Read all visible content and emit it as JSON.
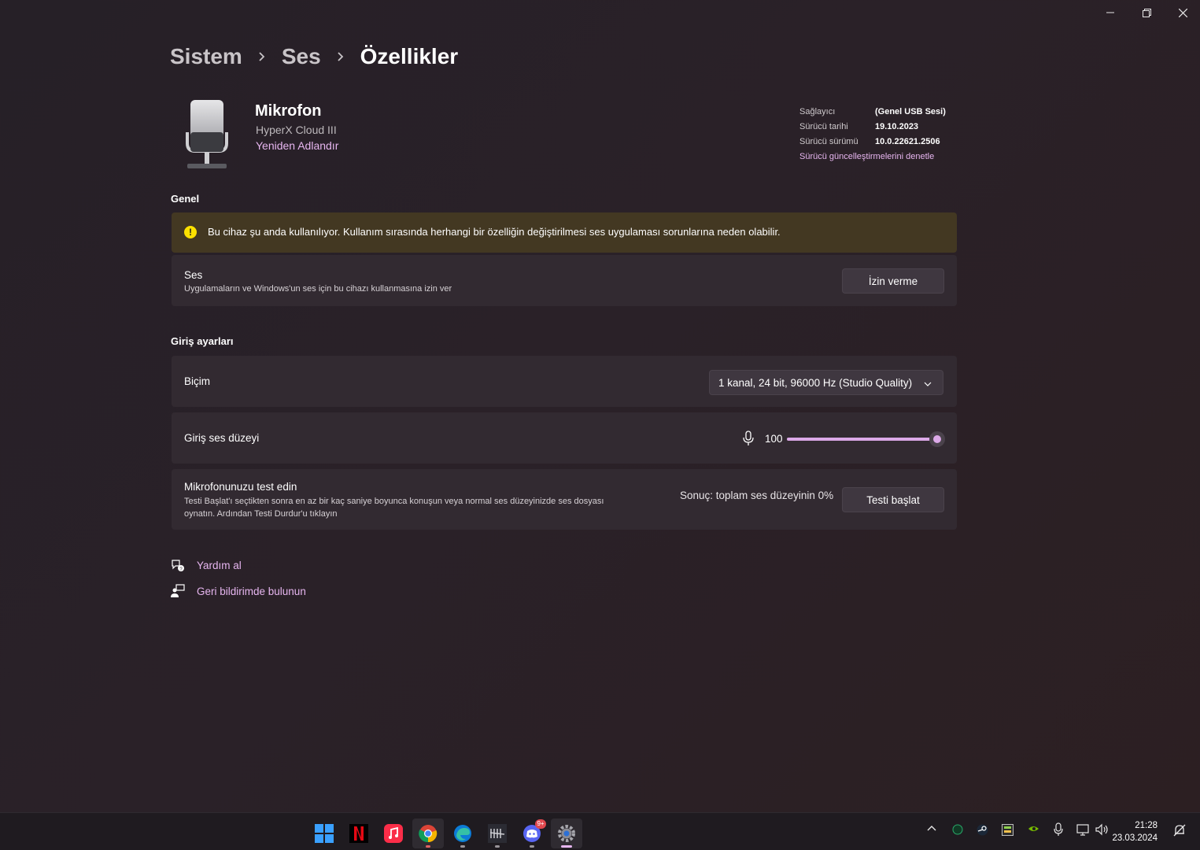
{
  "breadcrumb": {
    "item1": "Sistem",
    "item2": "Ses",
    "current": "Özellikler"
  },
  "device": {
    "name": "Mikrofon",
    "model": "HyperX Cloud III",
    "rename_link": "Yeniden Adlandır"
  },
  "driver": {
    "provider_label": "Sağlayıcı",
    "provider_value": "(Genel USB Sesi)",
    "date_label": "Sürücü tarihi",
    "date_value": "19.10.2023",
    "version_label": "Sürücü sürümü",
    "version_value": "10.0.22621.2506",
    "update_link": "Sürücü güncelleştirmelerini denetle"
  },
  "general": {
    "title": "Genel",
    "warning": "Bu cihaz şu anda kullanılıyor. Kullanım sırasında herhangi bir özelliğin değiştirilmesi ses uygulaması sorunlarına neden olabilir.",
    "audio_title": "Ses",
    "audio_sub": "Uygulamaların ve Windows'un ses için bu cihazı kullanmasına izin ver",
    "audio_button": "İzin verme"
  },
  "input": {
    "title": "Giriş ayarları",
    "format_label": "Biçim",
    "format_value": "1 kanal, 24 bit, 96000 Hz (Studio Quality)",
    "volume_label": "Giriş ses düzeyi",
    "volume_value": "100",
    "volume_fraction": 1.0,
    "test_title": "Mikrofonunuzu test edin",
    "test_sub_line1": "Testi Başlat'ı seçtikten sonra en az bir kaç saniye boyunca konuşun veya normal ses düzeyinizde ses dosyası",
    "test_sub_line2": "oynatın. Ardından Testi Durdur'u tıklayın",
    "test_result": "Sonuç: toplam ses düzeyinin 0%",
    "test_button": "Testi başlat"
  },
  "help": {
    "get_help": "Yardım al",
    "feedback": "Geri bildirimde bulunun"
  },
  "taskbar": {
    "discord_badge": "9+",
    "time": "21:28",
    "date": "23.03.2024",
    "apps": [
      "windows-start-icon",
      "netflix-icon",
      "apple-music-icon",
      "chrome-icon",
      "edge-icon",
      "dead-by-daylight-icon",
      "discord-icon",
      "settings-icon"
    ]
  },
  "colors": {
    "accent": "#e7b6f0",
    "warning_bg": "#433822",
    "card_bg": "#322a31"
  }
}
